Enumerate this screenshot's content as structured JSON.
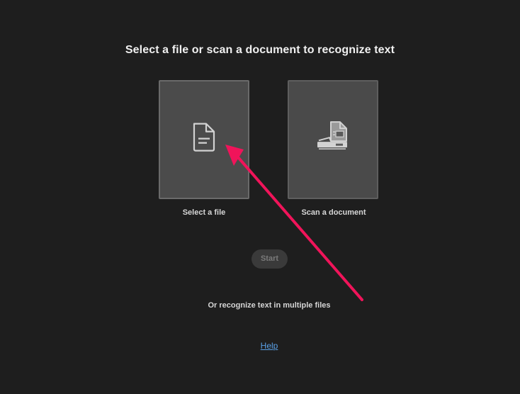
{
  "heading": "Select a file or scan a document to recognize text",
  "options": {
    "file": {
      "label": "Select a file",
      "icon": "document-icon"
    },
    "scan": {
      "label": "Scan a document",
      "icon": "scanner-icon"
    }
  },
  "start_button": {
    "label": "Start",
    "enabled": false
  },
  "multi_files_link": "Or recognize text in multiple files",
  "help_link": "Help",
  "colors": {
    "background": "#1e1e1e",
    "card": "#4a4a4a",
    "link": "#5aa0e6",
    "annotation_arrow": "#f0145a"
  }
}
